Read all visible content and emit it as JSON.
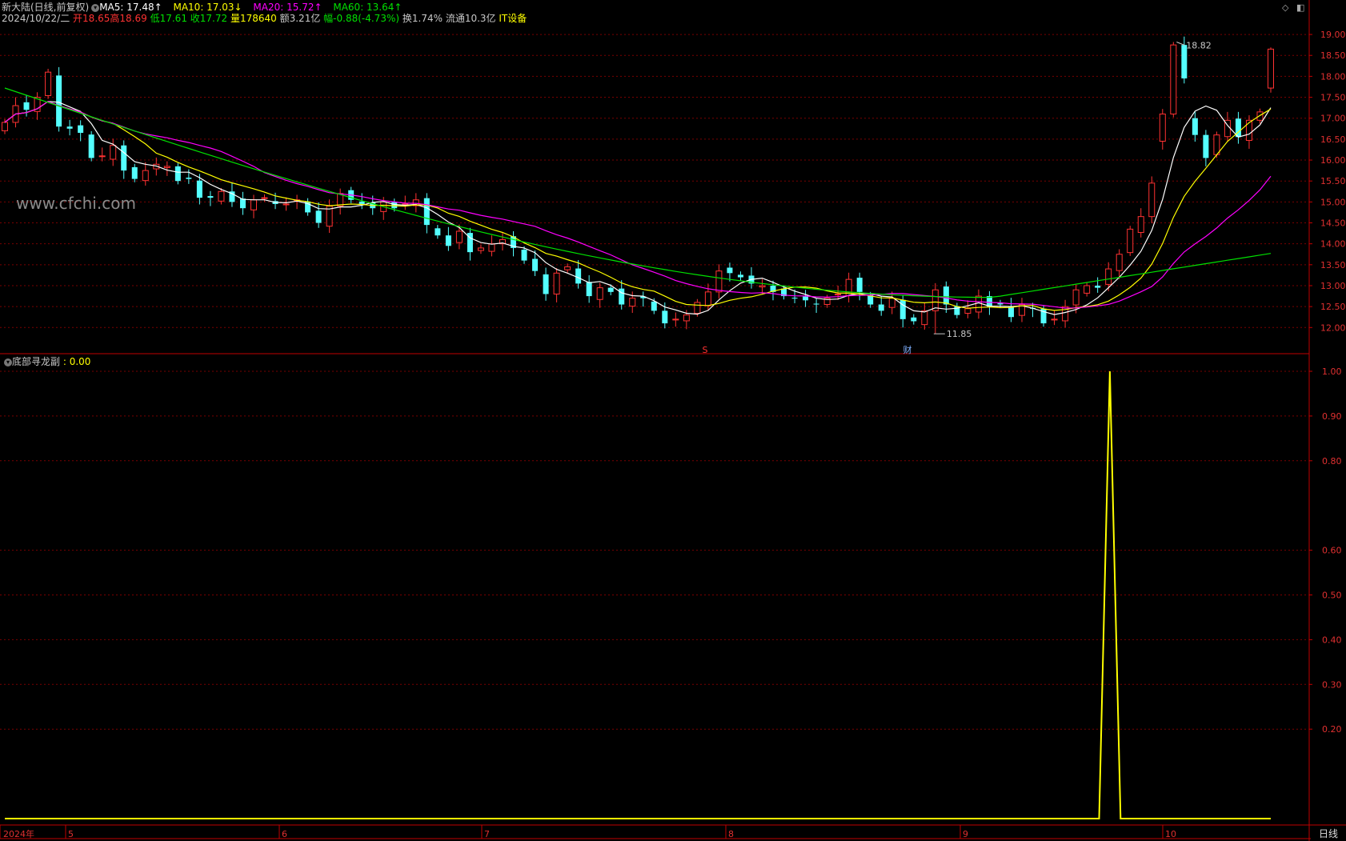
{
  "header": {
    "title": "新大陆(日线,前复权)",
    "ma5": "MA5: 17.48↑",
    "ma10": "MA10: 17.03↓",
    "ma20": "MA20: 15.72↑",
    "ma60": "MA60: 13.64↑",
    "date": "2024/10/22/二",
    "open": "开18.65",
    "high": "高18.69",
    "low": "低17.61",
    "close": "收17.72",
    "volume": "量178640",
    "amount": "额3.21亿",
    "change": "幅-0.88(-4.73%)",
    "turnover": "换1.74%",
    "float": "流通10.3亿",
    "sector": "IT设备"
  },
  "watermark": "www.cfchi.com",
  "annotations": {
    "high_label": "18.82",
    "low_label": "11.85",
    "marker_s": "S",
    "marker_cai": "财"
  },
  "indicator": {
    "name": "底部寻龙副",
    "value": ": 0.00"
  },
  "price_axis": [
    "19.00",
    "18.50",
    "18.00",
    "17.50",
    "17.00",
    "16.50",
    "16.00",
    "15.50",
    "15.00",
    "14.50",
    "14.00",
    "13.50",
    "13.00",
    "12.50",
    "12.00"
  ],
  "indicator_axis": [
    "1.00",
    "0.90",
    "0.80",
    "0.60",
    "0.50",
    "0.40",
    "0.30",
    "0.20"
  ],
  "date_axis": [
    "2024年",
    "5",
    "6",
    "7",
    "8",
    "9",
    "10"
  ],
  "period_button": "日线",
  "colors": {
    "up": "#ff3232",
    "down": "#54ffff",
    "ma5": "#ffffff",
    "ma10": "#ffff00",
    "ma20": "#ff00ff",
    "ma60": "#00e000",
    "grid": "#7a0000",
    "axis": "#c00000"
  },
  "chart_data": [
    {
      "type": "candlestick",
      "title": "新大陆(日线,前复权)",
      "ylim": [
        11.7,
        19.2
      ],
      "series": [
        {
          "name": "MA5",
          "values": [
            16.95,
            17.05,
            17.2,
            17.5,
            17.55,
            17.3,
            16.9,
            16.5,
            16.2,
            16.0,
            15.9,
            15.85,
            15.8,
            15.7,
            15.5,
            15.35,
            15.2,
            15.1,
            15.0,
            15.05,
            15.0,
            14.95,
            14.85,
            14.8,
            14.9,
            14.95,
            14.95,
            14.95,
            15.0,
            14.7,
            14.4,
            14.2,
            14.2,
            14.2,
            14.15,
            14.1,
            13.9,
            13.6,
            13.4,
            13.35,
            13.35,
            13.2,
            13.0,
            12.9,
            12.85,
            12.75,
            12.6,
            12.3,
            12.25,
            12.45,
            12.6,
            12.9,
            13.05,
            13.05,
            12.95,
            12.85,
            12.8,
            12.75,
            12.7,
            12.75,
            12.8,
            12.75,
            12.65,
            12.6,
            12.5,
            12.4,
            12.4,
            12.5,
            12.55,
            12.6,
            12.55,
            12.45,
            12.4,
            12.45,
            12.45,
            12.45,
            12.4,
            12.4,
            12.55,
            12.85,
            13.3,
            14.0,
            15.2,
            16.5,
            17.0,
            16.95,
            16.8,
            16.75,
            16.9,
            17.48
          ]
        },
        {
          "name": "MA10",
          "values": [
            16.9,
            16.95,
            17.0,
            17.1,
            17.15,
            17.15,
            17.1,
            17.0,
            16.85,
            16.6,
            16.35,
            16.15,
            16.0,
            15.9,
            15.75,
            15.55,
            15.4,
            15.3,
            15.25,
            15.15,
            15.1,
            15.05,
            14.95,
            14.95,
            14.95,
            14.95,
            14.95,
            14.9,
            14.85,
            14.8,
            14.6,
            14.45,
            14.3,
            14.2,
            14.15,
            14.0,
            13.8,
            13.6,
            13.45,
            13.3,
            13.15,
            12.95,
            12.85,
            12.75,
            12.7,
            12.6,
            12.55,
            12.6,
            12.7,
            12.8,
            12.9,
            12.95,
            12.95,
            12.95,
            12.9,
            12.85,
            12.8,
            12.75,
            12.7,
            12.65,
            12.6,
            12.55,
            12.5,
            12.5,
            12.5,
            12.5,
            12.5,
            12.5,
            12.5,
            12.45,
            12.45,
            12.45,
            12.45,
            12.5,
            12.65,
            12.95,
            13.4,
            14.0,
            14.8,
            15.4,
            15.9,
            16.3,
            16.6,
            16.75,
            17.0,
            17.03,
            17.03,
            17.03,
            17.03,
            17.03
          ]
        },
        {
          "name": "MA20",
          "values": [
            16.95,
            17.0,
            17.05,
            17.05,
            17.05,
            17.0,
            16.95,
            16.85,
            16.7,
            16.55,
            16.4,
            16.25,
            16.1,
            15.95,
            15.8,
            15.65,
            15.5,
            15.4,
            15.3,
            15.2,
            15.15,
            15.1,
            15.05,
            15.0,
            14.95,
            14.85,
            14.75,
            14.65,
            14.55,
            14.45,
            14.3,
            14.15,
            14.0,
            13.85,
            13.7,
            13.55,
            13.4,
            13.3,
            13.15,
            13.05,
            12.95,
            12.9,
            12.85,
            12.85,
            12.85,
            12.85,
            12.85,
            12.85,
            12.85,
            12.85,
            12.85,
            12.85,
            12.85,
            12.8,
            12.75,
            12.7,
            12.65,
            12.6,
            12.55,
            12.5,
            12.5,
            12.5,
            12.5,
            12.5,
            12.55,
            12.7,
            12.9,
            13.15,
            13.45,
            13.75,
            14.1,
            14.45,
            14.8,
            15.1,
            15.4,
            15.72,
            15.72,
            15.72,
            15.72,
            15.72,
            15.72,
            15.72,
            15.72,
            15.72,
            15.72,
            15.72,
            15.72,
            15.72,
            15.72,
            15.72
          ]
        },
        {
          "name": "MA60",
          "values": [
            17.65,
            17.7,
            17.7,
            17.72,
            17.72,
            17.7,
            17.65,
            17.55,
            17.45,
            17.3,
            17.15,
            17.0,
            16.85,
            16.7,
            16.5,
            16.35,
            16.2,
            16.05,
            15.9,
            15.75,
            15.6,
            15.45,
            15.3,
            15.15,
            15.0,
            14.85,
            14.65,
            14.5,
            14.35,
            14.2,
            14.1,
            13.95,
            13.85,
            13.75,
            13.65,
            13.55,
            13.45,
            13.35,
            13.25,
            13.15,
            13.05,
            12.95,
            12.9,
            12.85,
            12.85,
            12.9,
            12.95,
            13.05,
            13.15,
            13.3,
            13.45,
            13.64,
            13.64,
            13.64,
            13.64,
            13.64,
            13.64,
            13.64,
            13.64,
            13.64,
            13.64,
            13.64,
            13.64,
            13.64,
            13.64,
            13.64,
            13.64,
            13.64,
            13.64,
            13.64,
            13.64,
            13.64,
            13.64,
            13.64,
            13.64,
            13.64,
            13.64,
            13.64,
            13.64,
            13.64,
            13.64,
            13.64,
            13.64,
            13.64,
            13.64,
            13.64,
            13.64,
            13.64,
            13.64,
            13.64
          ]
        }
      ],
      "candles": [
        [
          16.7,
          17.0,
          16.55,
          17.1
        ],
        [
          17.0,
          17.35,
          16.95,
          17.4
        ],
        [
          17.3,
          17.15,
          17.1,
          17.45
        ],
        [
          17.25,
          17.5,
          17.2,
          17.6
        ],
        [
          17.6,
          18.15,
          17.55,
          18.2
        ],
        [
          17.85,
          16.8,
          16.6,
          17.9
        ],
        [
          16.85,
          16.7,
          16.6,
          16.9
        ],
        [
          16.75,
          16.65,
          16.5,
          16.8
        ],
        [
          16.6,
          16.0,
          15.95,
          16.7
        ],
        [
          16.0,
          16.1,
          15.8,
          16.25
        ],
        [
          16.2,
          16.3,
          16.1,
          16.4
        ],
        [
          16.15,
          15.75,
          15.6,
          16.25
        ],
        [
          15.7,
          15.55,
          15.5,
          15.8
        ],
        [
          15.55,
          15.75,
          15.5,
          15.9
        ],
        [
          15.85,
          15.95,
          15.75,
          16.0
        ],
        [
          15.95,
          15.85,
          15.8,
          16.0
        ],
        [
          15.8,
          15.5,
          15.45,
          15.9
        ],
        [
          15.5,
          15.55,
          15.45,
          15.6
        ],
        [
          15.5,
          15.1,
          15.05,
          15.55
        ],
        [
          15.15,
          15.05,
          15.0,
          15.2
        ],
        [
          15.05,
          15.25,
          14.9,
          15.35
        ],
        [
          15.25,
          15.0,
          14.95,
          15.3
        ],
        [
          15.0,
          14.8,
          14.75,
          15.05
        ],
        [
          14.75,
          15.05,
          14.55,
          15.1
        ],
        [
          14.95,
          15.1,
          14.9,
          15.3
        ],
        [
          15.25,
          14.95,
          14.9,
          15.3
        ],
        [
          14.95,
          14.95,
          14.85,
          15.05
        ],
        [
          14.95,
          15.05,
          14.85,
          15.1
        ],
        [
          15.1,
          14.75,
          14.7,
          15.2
        ],
        [
          14.75,
          14.5,
          14.45,
          14.85
        ],
        [
          14.5,
          14.85,
          14.35,
          14.9
        ],
        [
          14.85,
          15.2,
          14.8,
          15.3
        ],
        [
          15.2,
          15.05,
          14.9,
          15.25
        ],
        [
          15.0,
          14.9,
          14.85,
          15.05
        ],
        [
          14.95,
          14.85,
          14.8,
          15.05
        ],
        [
          14.9,
          15.0,
          14.85,
          15.05
        ],
        [
          15.05,
          14.9,
          14.85,
          15.1
        ],
        [
          14.95,
          15.0,
          14.85,
          15.05
        ],
        [
          15.05,
          14.95,
          14.9,
          15.1
        ]
      ]
    },
    {
      "type": "line",
      "title": "底部寻龙副",
      "ylim": [
        0,
        1.0
      ],
      "series": [
        {
          "name": "底部寻龙副",
          "values": [
            0,
            0,
            0,
            0,
            0,
            0,
            0,
            0,
            0,
            0,
            0,
            0,
            0,
            0,
            0,
            0,
            0,
            0,
            0,
            0,
            0,
            0,
            0,
            0,
            0,
            0,
            0,
            0,
            0,
            0,
            0,
            0,
            0,
            0,
            0,
            0,
            0,
            0,
            0,
            0,
            0,
            0,
            0,
            0,
            0,
            0,
            0,
            0,
            0,
            0,
            0,
            0,
            0,
            0,
            0,
            0,
            0,
            0,
            0,
            0,
            0,
            0,
            0,
            0,
            0,
            0,
            0,
            0,
            0,
            0,
            0,
            0,
            0,
            0,
            0,
            0,
            0,
            0,
            0,
            0,
            0,
            0,
            0,
            0,
            0,
            0,
            0,
            0,
            0,
            0,
            0,
            0,
            0,
            0,
            0,
            0,
            0,
            0,
            0,
            0,
            0,
            0,
            0,
            1,
            0,
            0,
            0,
            0,
            0,
            0,
            0,
            0,
            0,
            0,
            0,
            0,
            0,
            0,
            0
          ]
        }
      ]
    }
  ]
}
